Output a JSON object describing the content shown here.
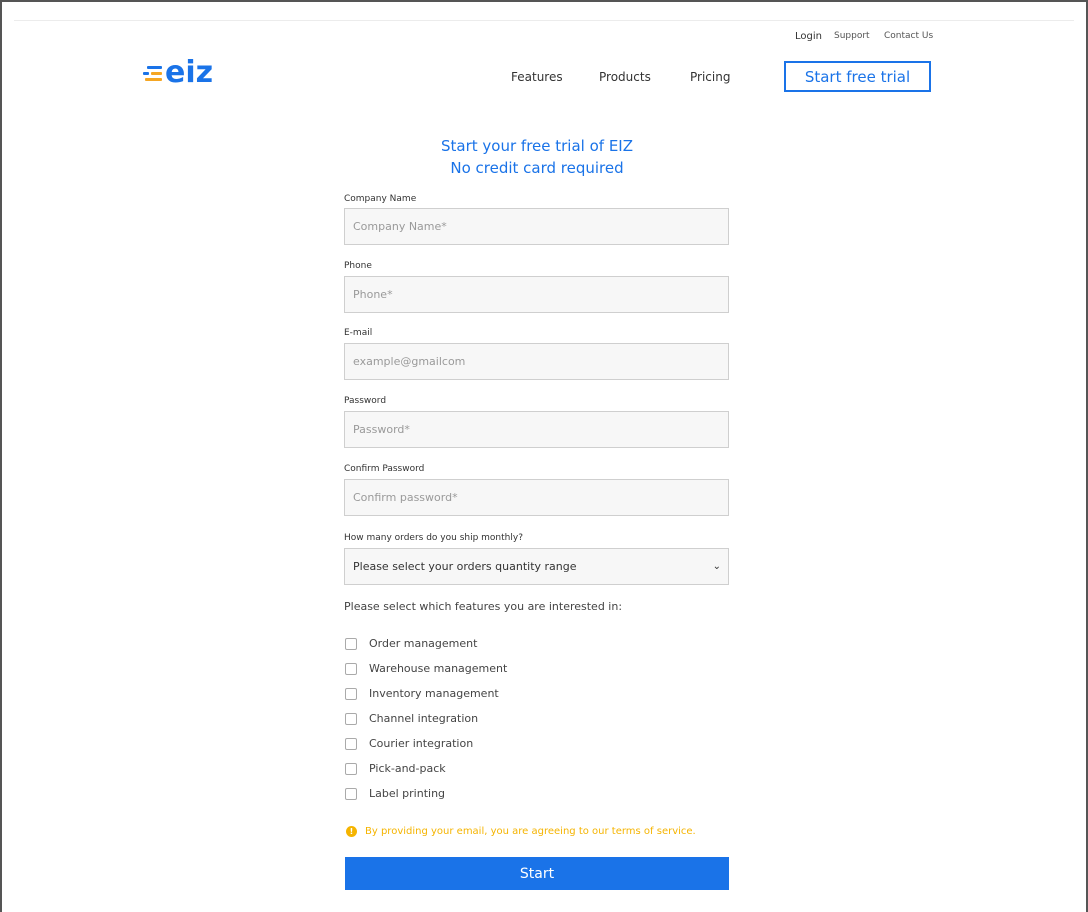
{
  "header": {
    "logo_text": "eiz",
    "util_links": {
      "login": "Login",
      "support": "Support",
      "contact": "Contact Us"
    },
    "nav": {
      "features": "Features",
      "products": "Products",
      "pricing": "Pricing"
    },
    "cta_label": "Start free trial"
  },
  "colors": {
    "brand": "#1a73e8",
    "accent_yellow": "#f5b400",
    "logo_orange": "#f5a623"
  },
  "form": {
    "heading_line1": "Start your free trial of EIZ",
    "heading_line2": "No credit card required",
    "fields": [
      {
        "label": "Company Name",
        "placeholder": "Company Name*",
        "value": ""
      },
      {
        "label": "Phone",
        "placeholder": "Phone*",
        "value": ""
      },
      {
        "label": "E-mail",
        "placeholder": "example@gmailcom",
        "value": ""
      },
      {
        "label": "Password",
        "placeholder": "Password*",
        "value": ""
      },
      {
        "label": "Confirm Password",
        "placeholder": "Confirm password*",
        "value": ""
      }
    ],
    "orders": {
      "label": "How many orders do you ship monthly?",
      "selected": "Please select your orders quantity range"
    },
    "features_title": "Please select which features you are interested in:",
    "features": [
      {
        "label": "Order management",
        "checked": false
      },
      {
        "label": "Warehouse management",
        "checked": false
      },
      {
        "label": "Inventory management",
        "checked": false
      },
      {
        "label": "Channel integration",
        "checked": false
      },
      {
        "label": "Courier integration",
        "checked": false
      },
      {
        "label": "Pick-and-pack",
        "checked": false
      },
      {
        "label": "Label printing",
        "checked": false
      }
    ],
    "notice": "By providing your email, you are agreeing to our terms of service.",
    "submit_label": "Start"
  }
}
